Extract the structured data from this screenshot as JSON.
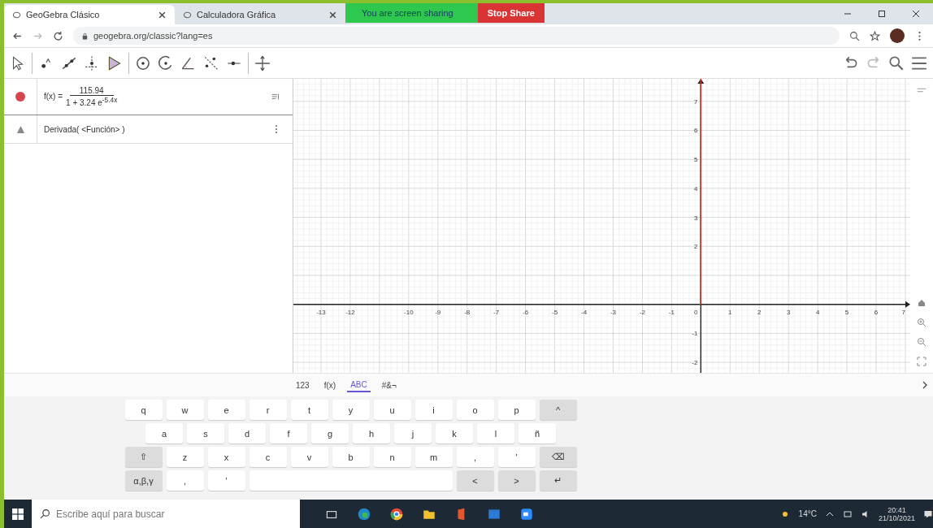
{
  "browser": {
    "tabs": [
      {
        "title": "GeoGebra Clásico",
        "selected": true
      },
      {
        "title": "Calculadora Gráfica",
        "selected": false
      }
    ],
    "share_banner": {
      "status": "You are screen sharing",
      "stop_button": "Stop Share"
    },
    "url": "geogebra.org/classic?lang=es"
  },
  "algebra": {
    "items": [
      {
        "kind": "function",
        "name": "f(x) =",
        "numerator": "115.94",
        "denominator": "1 + 3.24 e$^{-5.4x}$"
      },
      {
        "kind": "input",
        "text": "Derivada( <Función> )"
      }
    ]
  },
  "graphics": {
    "x_labels": [
      "-13",
      "-12",
      "-10",
      "-9",
      "-8",
      "-7",
      "-6",
      "-5",
      "-4",
      "-3",
      "-2",
      "-1",
      "0",
      "1",
      "2",
      "3",
      "4",
      "5",
      "6",
      "7"
    ],
    "y_labels": [
      "7",
      "6",
      "5",
      "4",
      "3",
      "2",
      "-1",
      "-2"
    ]
  },
  "keyboard": {
    "tabs": [
      {
        "label": "123",
        "selected": false
      },
      {
        "label": "f(x)",
        "selected": false
      },
      {
        "label": "ABC",
        "selected": true
      },
      {
        "label": "#&¬",
        "selected": false
      }
    ],
    "rows": [
      {
        "keys": [
          {
            "kind": "char",
            "label": "q"
          },
          {
            "kind": "char",
            "label": "w"
          },
          {
            "kind": "char",
            "label": "e"
          },
          {
            "kind": "char",
            "label": "r"
          },
          {
            "kind": "char",
            "label": "t"
          },
          {
            "kind": "char",
            "label": "y"
          },
          {
            "kind": "char",
            "label": "u"
          },
          {
            "kind": "char",
            "label": "i"
          },
          {
            "kind": "char",
            "label": "o"
          },
          {
            "kind": "char",
            "label": "p"
          },
          {
            "kind": "func",
            "label": "^"
          }
        ]
      },
      {
        "keys": [
          {
            "kind": "char",
            "label": "a"
          },
          {
            "kind": "char",
            "label": "s"
          },
          {
            "kind": "char",
            "label": "d"
          },
          {
            "kind": "char",
            "label": "f"
          },
          {
            "kind": "char",
            "label": "g"
          },
          {
            "kind": "char",
            "label": "h"
          },
          {
            "kind": "char",
            "label": "j"
          },
          {
            "kind": "char",
            "label": "k"
          },
          {
            "kind": "char",
            "label": "l"
          },
          {
            "kind": "char",
            "label": "ñ"
          }
        ]
      },
      {
        "keys": [
          {
            "kind": "func",
            "label": "⇧"
          },
          {
            "kind": "char",
            "label": "z"
          },
          {
            "kind": "char",
            "label": "x"
          },
          {
            "kind": "char",
            "label": "c"
          },
          {
            "kind": "char",
            "label": "v"
          },
          {
            "kind": "char",
            "label": "b"
          },
          {
            "kind": "char",
            "label": "n"
          },
          {
            "kind": "char",
            "label": "m"
          },
          {
            "kind": "char",
            "label": ","
          },
          {
            "kind": "char",
            "label": "'"
          },
          {
            "kind": "func",
            "label": "⌫"
          }
        ]
      },
      {
        "keys": [
          {
            "kind": "func",
            "label": "α,β,γ"
          },
          {
            "kind": "char",
            "label": ","
          },
          {
            "kind": "char",
            "label": "'"
          },
          {
            "kind": "space"
          },
          {
            "kind": "func",
            "label": "<"
          },
          {
            "kind": "func",
            "label": ">"
          },
          {
            "kind": "func",
            "label": "↵"
          }
        ]
      }
    ]
  },
  "taskbar": {
    "search_placeholder": "Escribe aquí para buscar",
    "weather": "14°C",
    "time": "20:41",
    "date": "21/10/2021"
  }
}
